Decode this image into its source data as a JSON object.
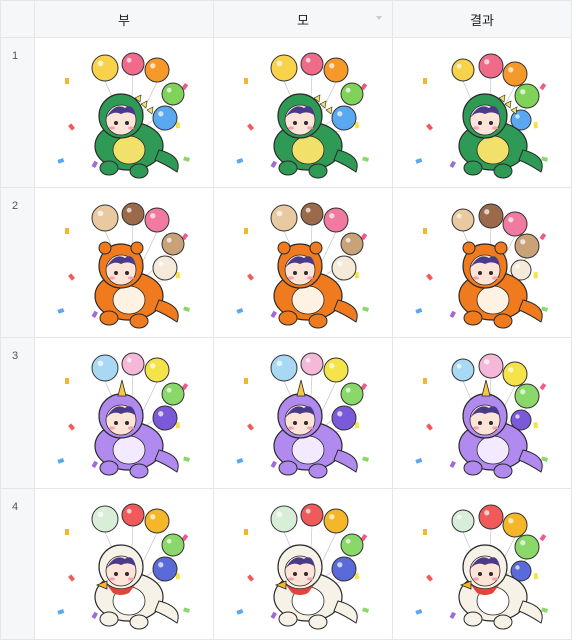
{
  "table": {
    "columns": [
      "부",
      "모",
      "결과"
    ],
    "rows": [
      {
        "index": "1",
        "theme": "dinosaur",
        "costume": "#2f9a56",
        "belly": "#f1e06a",
        "accents": [
          "#f7d24a",
          "#f06a8a",
          "#f59a2a",
          "#7fd25a",
          "#5aa8f0"
        ]
      },
      {
        "index": "2",
        "theme": "red-panda",
        "costume": "#f07a1e",
        "belly": "#fff2e2",
        "accents": [
          "#e8c9a0",
          "#9a6a4a",
          "#f07aa0",
          "#c9a27a",
          "#f5e9da"
        ]
      },
      {
        "index": "3",
        "theme": "unicorn",
        "costume": "#b18af0",
        "belly": "#f4eaff",
        "accents": [
          "#a9d8f5",
          "#f5b8d8",
          "#f5e34a",
          "#8ad86a",
          "#7a5ad8"
        ]
      },
      {
        "index": "4",
        "theme": "duck",
        "costume": "#f6f2e8",
        "belly": "#ffffff",
        "accents": [
          "#d8eed8",
          "#f05a5a",
          "#f5b72a",
          "#8ad86a",
          "#5a6ad8"
        ]
      }
    ]
  }
}
